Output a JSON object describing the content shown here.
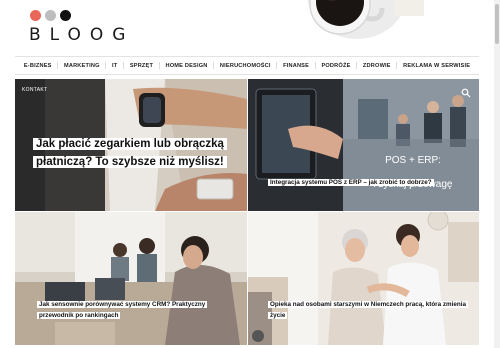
{
  "header": {
    "logo": "BLOOG",
    "dots": {
      "colors": [
        "#e8665a",
        "#bdbdbd",
        "#111111"
      ]
    }
  },
  "nav": {
    "items": [
      {
        "label": "E-BIZNES"
      },
      {
        "label": "MARKETING"
      },
      {
        "label": "IT"
      },
      {
        "label": "SPRZĘT"
      },
      {
        "label": "HOME DESIGN"
      },
      {
        "label": "NIERUCHOMOŚCI"
      },
      {
        "label": "FINANSE"
      },
      {
        "label": "PODRÓŻE"
      },
      {
        "label": "ZDROWIE"
      },
      {
        "label": "REKLAMA W SERWISIE"
      }
    ]
  },
  "topbar": {
    "contact": "KONTAKT",
    "search_icon": "search-icon"
  },
  "posts": [
    {
      "title": "Jak płacić zegarkiem lub obrączką płatniczą? To szybsze niż myślisz!"
    },
    {
      "title": "Integracja systemu POS z ERP – jak zrobić to dobrze?",
      "image_text_1": "POS + ERP:",
      "image_text_2": "i zyskaj przewagę"
    },
    {
      "title": "Jak sensownie porównywać systemy CRM? Praktyczny przewodnik po rankingach"
    },
    {
      "title": "Opieka nad osobami starszymi w Niemczech pracą, która zmienia życie"
    }
  ]
}
